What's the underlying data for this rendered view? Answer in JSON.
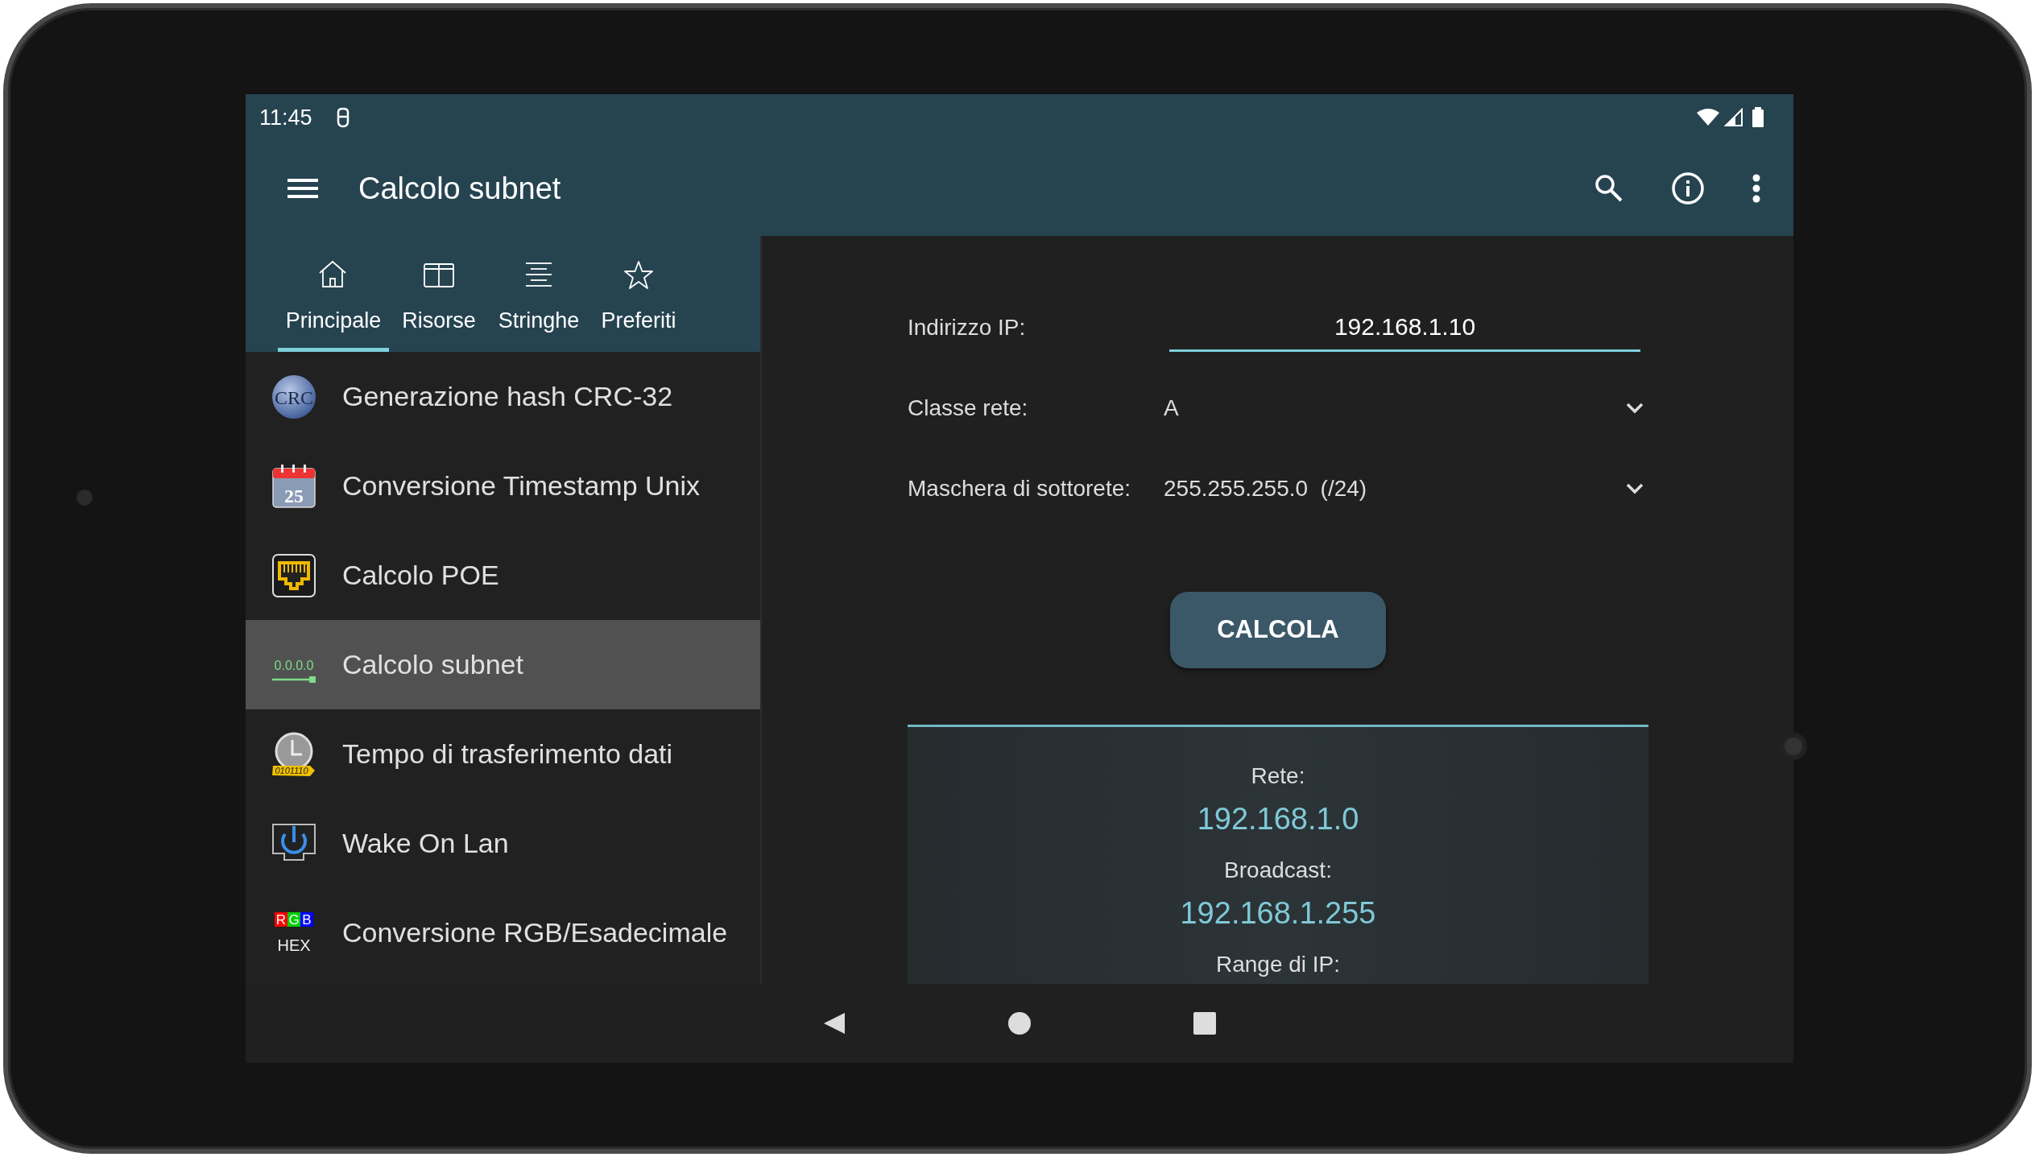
{
  "status_bar": {
    "time": "11:45"
  },
  "app_bar": {
    "title": "Calcolo subnet"
  },
  "tabs": [
    {
      "label": "Principale",
      "kind": "home",
      "selected": true
    },
    {
      "label": "Risorse",
      "kind": "panels",
      "selected": false
    },
    {
      "label": "Stringhe",
      "kind": "lines",
      "selected": false
    },
    {
      "label": "Preferiti",
      "kind": "star",
      "selected": false
    }
  ],
  "sidebar": {
    "items": [
      {
        "label": "Generazione hash CRC-32",
        "kind": "crc",
        "icon_text": [
          "CRC"
        ],
        "selected": false
      },
      {
        "label": "Conversione Timestamp Unix",
        "kind": "calendar",
        "icon_text": [
          "25"
        ],
        "selected": false
      },
      {
        "label": "Calcolo POE",
        "kind": "port",
        "selected": false
      },
      {
        "label": "Calcolo subnet",
        "kind": "subnet",
        "icon_text": [
          "0.0.0.0"
        ],
        "selected": true
      },
      {
        "label": "Tempo di trasferimento dati",
        "kind": "clock",
        "icon_text": [
          "0101110"
        ],
        "selected": false
      },
      {
        "label": "Wake On Lan",
        "kind": "power",
        "selected": false
      },
      {
        "label": "Conversione RGB/Esadecimale",
        "kind": "rgb",
        "icon_text": [
          "R",
          "G",
          "B",
          "HEX"
        ],
        "selected": false
      }
    ]
  },
  "form": {
    "fields": [
      {
        "kind": "input",
        "label": "Indirizzo IP:",
        "value": "192.168.1.10",
        "focused": true
      },
      {
        "kind": "dropdown",
        "label": "Classe rete:",
        "value": "A"
      },
      {
        "kind": "dropdown",
        "label": "Maschera di sottorete:",
        "value": "255.255.255.0  (/24)"
      }
    ],
    "button": "CALCOLA"
  },
  "results": [
    {
      "label": "Rete:",
      "value": "192.168.1.0"
    },
    {
      "label": "Broadcast:",
      "value": "192.168.1.255"
    },
    {
      "label": "Range di IP:"
    }
  ]
}
